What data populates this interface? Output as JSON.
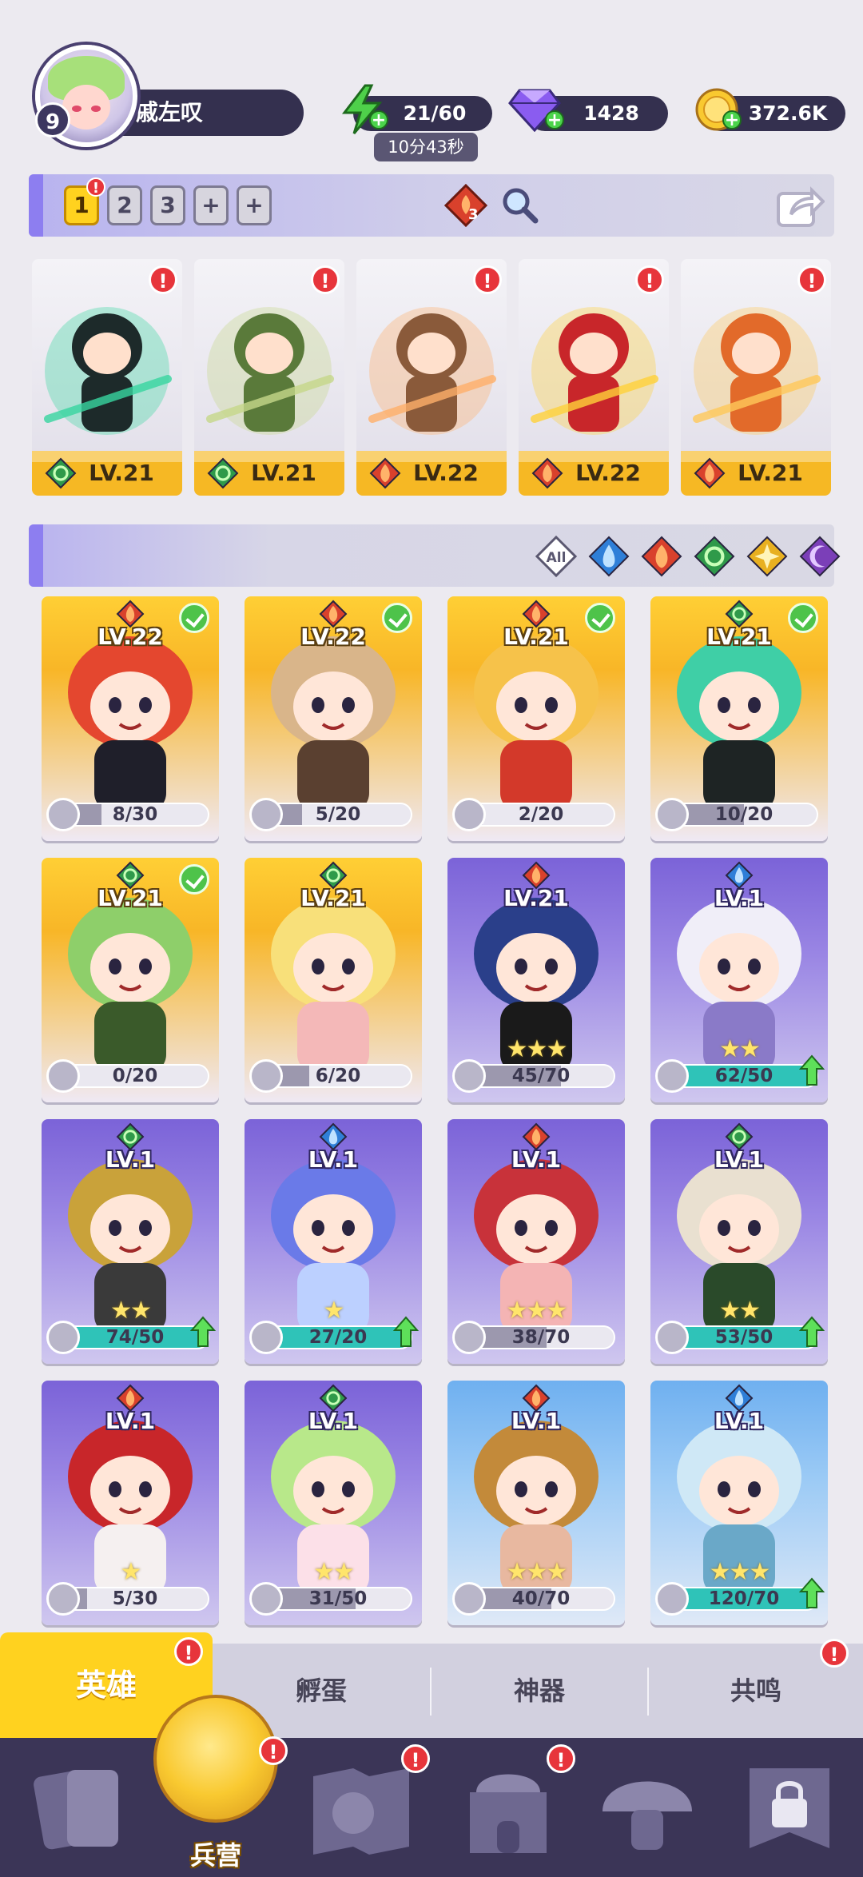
{
  "player": {
    "level": "9",
    "name": "戚左叹"
  },
  "resources": {
    "energy": "21/60",
    "energy_timer": "10分43秒",
    "gems": "1428",
    "coins": "372.6K"
  },
  "team_bar": {
    "slots": [
      "1",
      "2",
      "3",
      "+",
      "+"
    ],
    "active_slot": "1",
    "slot_alert": "!",
    "bag_count": "3"
  },
  "team": [
    {
      "level": "LV.21",
      "element": "wind",
      "alert": "!"
    },
    {
      "level": "LV.21",
      "element": "wind",
      "alert": "!"
    },
    {
      "level": "LV.22",
      "element": "fire",
      "alert": "!"
    },
    {
      "level": "LV.22",
      "element": "fire",
      "alert": "!"
    },
    {
      "level": "LV.21",
      "element": "fire",
      "alert": "!"
    }
  ],
  "filters": [
    "All",
    "water",
    "fire",
    "wind",
    "light",
    "dark"
  ],
  "heroes": [
    {
      "level": "LV.22",
      "element": "fire",
      "progress": "8/30",
      "fraction": 0.27,
      "in_team": true,
      "style": "gold",
      "stars": "",
      "upgrade": false
    },
    {
      "level": "LV.22",
      "element": "fire",
      "progress": "5/20",
      "fraction": 0.25,
      "in_team": true,
      "style": "gold",
      "stars": "",
      "upgrade": false
    },
    {
      "level": "LV.21",
      "element": "fire",
      "progress": "2/20",
      "fraction": 0.1,
      "in_team": true,
      "style": "gold",
      "stars": "",
      "upgrade": false
    },
    {
      "level": "LV.21",
      "element": "wind",
      "progress": "10/20",
      "fraction": 0.5,
      "in_team": true,
      "style": "gold",
      "stars": "",
      "upgrade": false
    },
    {
      "level": "LV.21",
      "element": "wind",
      "progress": "0/20",
      "fraction": 0.0,
      "in_team": true,
      "style": "gold",
      "stars": "",
      "upgrade": false
    },
    {
      "level": "LV.21",
      "element": "wind",
      "progress": "6/20",
      "fraction": 0.3,
      "in_team": false,
      "style": "gold",
      "stars": "",
      "upgrade": false
    },
    {
      "level": "LV.21",
      "element": "fire",
      "progress": "45/70",
      "fraction": 0.64,
      "in_team": false,
      "style": "purple",
      "stars": "★★★",
      "upgrade": false
    },
    {
      "level": "LV.1",
      "element": "water",
      "progress": "62/50",
      "fraction": 1.0,
      "in_team": false,
      "style": "purple",
      "stars": "★★",
      "upgrade": true
    },
    {
      "level": "LV.1",
      "element": "wind",
      "progress": "74/50",
      "fraction": 1.0,
      "in_team": false,
      "style": "purple",
      "stars": "★★",
      "upgrade": true
    },
    {
      "level": "LV.1",
      "element": "water",
      "progress": "27/20",
      "fraction": 1.0,
      "in_team": false,
      "style": "purple",
      "stars": "★",
      "upgrade": true
    },
    {
      "level": "LV.1",
      "element": "fire",
      "progress": "38/70",
      "fraction": 0.54,
      "in_team": false,
      "style": "purple",
      "stars": "★★★",
      "upgrade": false
    },
    {
      "level": "LV.1",
      "element": "wind",
      "progress": "53/50",
      "fraction": 1.0,
      "in_team": false,
      "style": "purple",
      "stars": "★★",
      "upgrade": true
    },
    {
      "level": "LV.1",
      "element": "fire",
      "progress": "5/30",
      "fraction": 0.17,
      "in_team": false,
      "style": "purple",
      "stars": "★",
      "upgrade": false
    },
    {
      "level": "LV.1",
      "element": "wind",
      "progress": "31/50",
      "fraction": 0.62,
      "in_team": false,
      "style": "purple",
      "stars": "★★",
      "upgrade": false
    },
    {
      "level": "LV.1",
      "element": "fire",
      "progress": "40/70",
      "fraction": 0.57,
      "in_team": false,
      "style": "blue",
      "stars": "★★★",
      "upgrade": false
    },
    {
      "level": "LV.1",
      "element": "water",
      "progress": "120/70",
      "fraction": 1.0,
      "in_team": false,
      "style": "blue",
      "stars": "★★★",
      "upgrade": true
    }
  ],
  "subtabs": [
    {
      "label": "英雄",
      "active": true,
      "alert": "!"
    },
    {
      "label": "孵蛋",
      "active": false,
      "alert": ""
    },
    {
      "label": "神器",
      "active": false,
      "alert": ""
    },
    {
      "label": "共鸣",
      "active": false,
      "alert": "!"
    }
  ],
  "nav": {
    "center_label": "兵营",
    "items": [
      "cards",
      "barracks",
      "map",
      "castle",
      "mushroom",
      "locked"
    ]
  },
  "colors": {
    "fire": "#d9412c",
    "wind": "#2f9a4a",
    "water": "#2f7fd8",
    "light": "#e8b020",
    "dark": "#7b3fb8",
    "gold_bar": "#f6b824",
    "alert": "#e7353b"
  }
}
